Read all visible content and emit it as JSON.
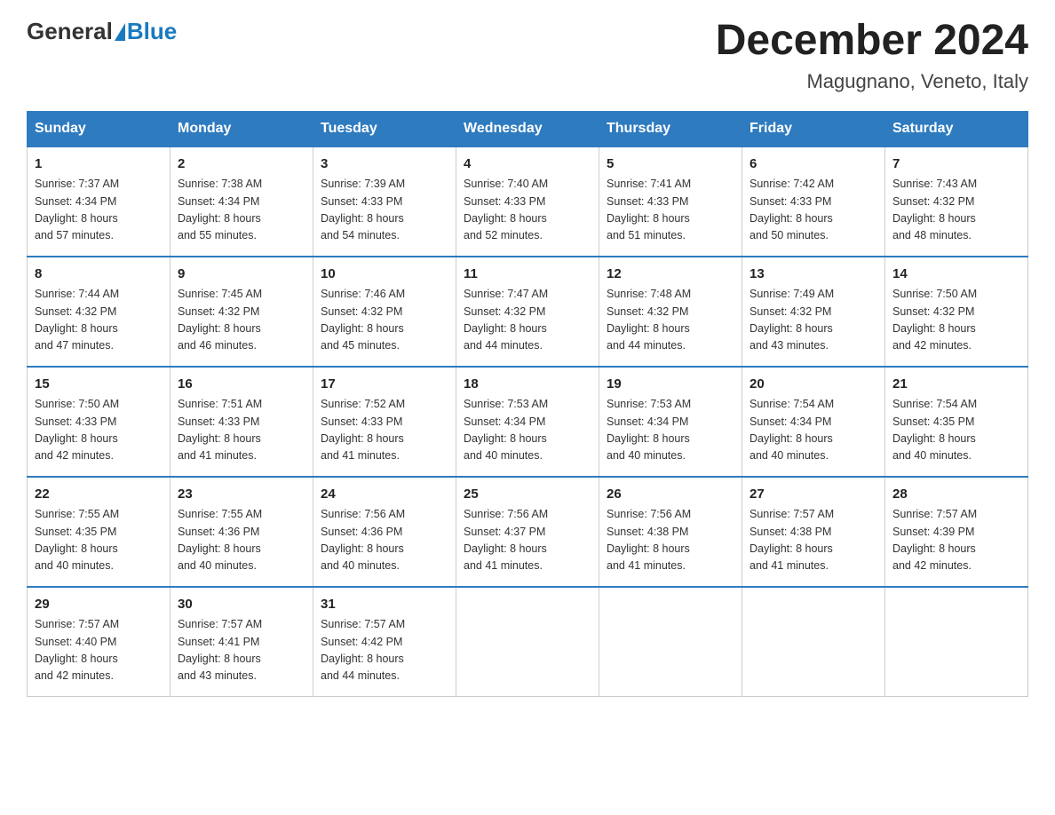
{
  "header": {
    "logo_general": "General",
    "logo_blue": "Blue",
    "title": "December 2024",
    "subtitle": "Magugnano, Veneto, Italy"
  },
  "days_of_week": [
    "Sunday",
    "Monday",
    "Tuesday",
    "Wednesday",
    "Thursday",
    "Friday",
    "Saturday"
  ],
  "weeks": [
    [
      {
        "day": "1",
        "sunrise": "7:37 AM",
        "sunset": "4:34 PM",
        "daylight": "8 hours and 57 minutes."
      },
      {
        "day": "2",
        "sunrise": "7:38 AM",
        "sunset": "4:34 PM",
        "daylight": "8 hours and 55 minutes."
      },
      {
        "day": "3",
        "sunrise": "7:39 AM",
        "sunset": "4:33 PM",
        "daylight": "8 hours and 54 minutes."
      },
      {
        "day": "4",
        "sunrise": "7:40 AM",
        "sunset": "4:33 PM",
        "daylight": "8 hours and 52 minutes."
      },
      {
        "day": "5",
        "sunrise": "7:41 AM",
        "sunset": "4:33 PM",
        "daylight": "8 hours and 51 minutes."
      },
      {
        "day": "6",
        "sunrise": "7:42 AM",
        "sunset": "4:33 PM",
        "daylight": "8 hours and 50 minutes."
      },
      {
        "day": "7",
        "sunrise": "7:43 AM",
        "sunset": "4:32 PM",
        "daylight": "8 hours and 48 minutes."
      }
    ],
    [
      {
        "day": "8",
        "sunrise": "7:44 AM",
        "sunset": "4:32 PM",
        "daylight": "8 hours and 47 minutes."
      },
      {
        "day": "9",
        "sunrise": "7:45 AM",
        "sunset": "4:32 PM",
        "daylight": "8 hours and 46 minutes."
      },
      {
        "day": "10",
        "sunrise": "7:46 AM",
        "sunset": "4:32 PM",
        "daylight": "8 hours and 45 minutes."
      },
      {
        "day": "11",
        "sunrise": "7:47 AM",
        "sunset": "4:32 PM",
        "daylight": "8 hours and 44 minutes."
      },
      {
        "day": "12",
        "sunrise": "7:48 AM",
        "sunset": "4:32 PM",
        "daylight": "8 hours and 44 minutes."
      },
      {
        "day": "13",
        "sunrise": "7:49 AM",
        "sunset": "4:32 PM",
        "daylight": "8 hours and 43 minutes."
      },
      {
        "day": "14",
        "sunrise": "7:50 AM",
        "sunset": "4:32 PM",
        "daylight": "8 hours and 42 minutes."
      }
    ],
    [
      {
        "day": "15",
        "sunrise": "7:50 AM",
        "sunset": "4:33 PM",
        "daylight": "8 hours and 42 minutes."
      },
      {
        "day": "16",
        "sunrise": "7:51 AM",
        "sunset": "4:33 PM",
        "daylight": "8 hours and 41 minutes."
      },
      {
        "day": "17",
        "sunrise": "7:52 AM",
        "sunset": "4:33 PM",
        "daylight": "8 hours and 41 minutes."
      },
      {
        "day": "18",
        "sunrise": "7:53 AM",
        "sunset": "4:34 PM",
        "daylight": "8 hours and 40 minutes."
      },
      {
        "day": "19",
        "sunrise": "7:53 AM",
        "sunset": "4:34 PM",
        "daylight": "8 hours and 40 minutes."
      },
      {
        "day": "20",
        "sunrise": "7:54 AM",
        "sunset": "4:34 PM",
        "daylight": "8 hours and 40 minutes."
      },
      {
        "day": "21",
        "sunrise": "7:54 AM",
        "sunset": "4:35 PM",
        "daylight": "8 hours and 40 minutes."
      }
    ],
    [
      {
        "day": "22",
        "sunrise": "7:55 AM",
        "sunset": "4:35 PM",
        "daylight": "8 hours and 40 minutes."
      },
      {
        "day": "23",
        "sunrise": "7:55 AM",
        "sunset": "4:36 PM",
        "daylight": "8 hours and 40 minutes."
      },
      {
        "day": "24",
        "sunrise": "7:56 AM",
        "sunset": "4:36 PM",
        "daylight": "8 hours and 40 minutes."
      },
      {
        "day": "25",
        "sunrise": "7:56 AM",
        "sunset": "4:37 PM",
        "daylight": "8 hours and 41 minutes."
      },
      {
        "day": "26",
        "sunrise": "7:56 AM",
        "sunset": "4:38 PM",
        "daylight": "8 hours and 41 minutes."
      },
      {
        "day": "27",
        "sunrise": "7:57 AM",
        "sunset": "4:38 PM",
        "daylight": "8 hours and 41 minutes."
      },
      {
        "day": "28",
        "sunrise": "7:57 AM",
        "sunset": "4:39 PM",
        "daylight": "8 hours and 42 minutes."
      }
    ],
    [
      {
        "day": "29",
        "sunrise": "7:57 AM",
        "sunset": "4:40 PM",
        "daylight": "8 hours and 42 minutes."
      },
      {
        "day": "30",
        "sunrise": "7:57 AM",
        "sunset": "4:41 PM",
        "daylight": "8 hours and 43 minutes."
      },
      {
        "day": "31",
        "sunrise": "7:57 AM",
        "sunset": "4:42 PM",
        "daylight": "8 hours and 44 minutes."
      },
      null,
      null,
      null,
      null
    ]
  ],
  "labels": {
    "sunrise_prefix": "Sunrise: ",
    "sunset_prefix": "Sunset: ",
    "daylight_prefix": "Daylight: "
  }
}
